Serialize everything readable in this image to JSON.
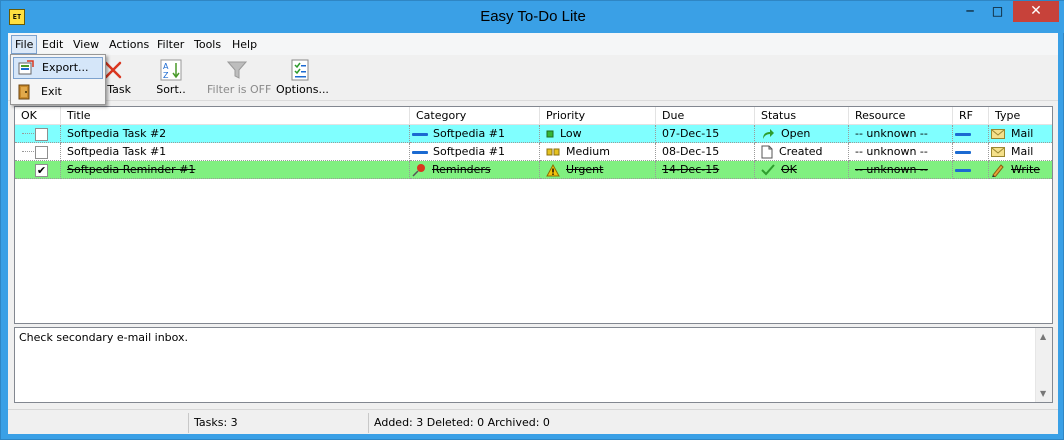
{
  "window": {
    "title": "Easy To-Do Lite",
    "icon_label": "ET",
    "min_glyph": "─",
    "max_glyph": "□",
    "close_glyph": "✕"
  },
  "menubar": [
    {
      "label": "File"
    },
    {
      "label": "Edit"
    },
    {
      "label": "View"
    },
    {
      "label": "Actions"
    },
    {
      "label": "Filter"
    },
    {
      "label": "Tools"
    },
    {
      "label": "Help"
    }
  ],
  "file_menu": {
    "items": [
      {
        "label": "Export...",
        "icon": "export-icon"
      },
      {
        "label": "Exit",
        "icon": "exit-icon"
      }
    ]
  },
  "toolbar": {
    "buttons": [
      {
        "label": "e Task",
        "icon": "delete-task-icon"
      },
      {
        "label": "Sort..",
        "icon": "sort-icon"
      },
      {
        "label": "Filter is OFF",
        "icon": "filter-icon",
        "disabled": true
      },
      {
        "label": "Options...",
        "icon": "options-icon"
      }
    ]
  },
  "table": {
    "headers": [
      "OK",
      "Title",
      "Category",
      "Priority",
      "Due",
      "Status",
      "Resource",
      "RF",
      "Type"
    ],
    "rows": [
      {
        "ok": false,
        "title": "Softpedia Task #2",
        "category": "Softpedia #1",
        "priority": "Low",
        "due": "07-Dec-15",
        "status": "Open",
        "resource": "-- unknown --",
        "type": "Mail",
        "row_color": "#80ffff"
      },
      {
        "ok": false,
        "title": "Softpedia Task #1",
        "category": "Softpedia #1",
        "priority": "Medium",
        "due": "08-Dec-15",
        "status": "Created",
        "resource": "-- unknown --",
        "type": "Mail",
        "row_color": "#ffffff"
      },
      {
        "ok": true,
        "title": "Softpedia Reminder #1",
        "category": "Reminders",
        "priority": "Urgent",
        "due": "14-Dec-15",
        "status": "OK",
        "resource": "-- unknown --",
        "type": "Write",
        "row_color": "#80f080"
      }
    ]
  },
  "notes": {
    "text": "Check secondary e-mail inbox."
  },
  "statusbar": {
    "tasks": "Tasks: 3",
    "summary": "Added: 3 Deleted: 0 Archived: 0"
  },
  "colors": {
    "titlebar": "#3aa0e6",
    "close_button": "#c7423a",
    "accent_blue": "#1b6ad1"
  }
}
